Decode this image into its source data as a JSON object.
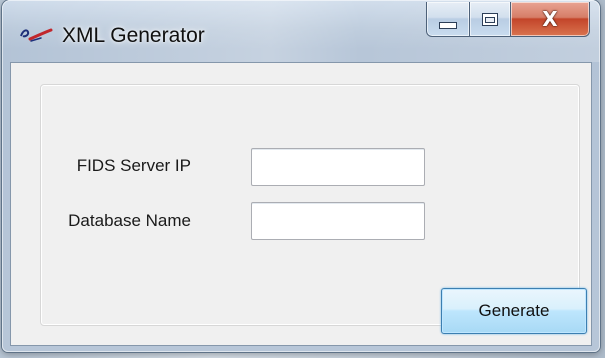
{
  "window": {
    "title": "XML Generator",
    "app_icon": "xml-generator-app-icon",
    "controls": {
      "minimize_icon": "minimize-icon",
      "maximize_icon": "maximize-icon",
      "close_icon": "close-icon",
      "close_glyph": "X"
    }
  },
  "form": {
    "server_ip": {
      "label": "FIDS Server IP",
      "value": ""
    },
    "database_name": {
      "label": "Database Name",
      "value": ""
    },
    "generate_button": {
      "label": "Generate"
    }
  },
  "colors": {
    "close_button": "#c3452a",
    "focus_button_border": "#3c7fb1",
    "client_background": "#f0f0f0"
  }
}
